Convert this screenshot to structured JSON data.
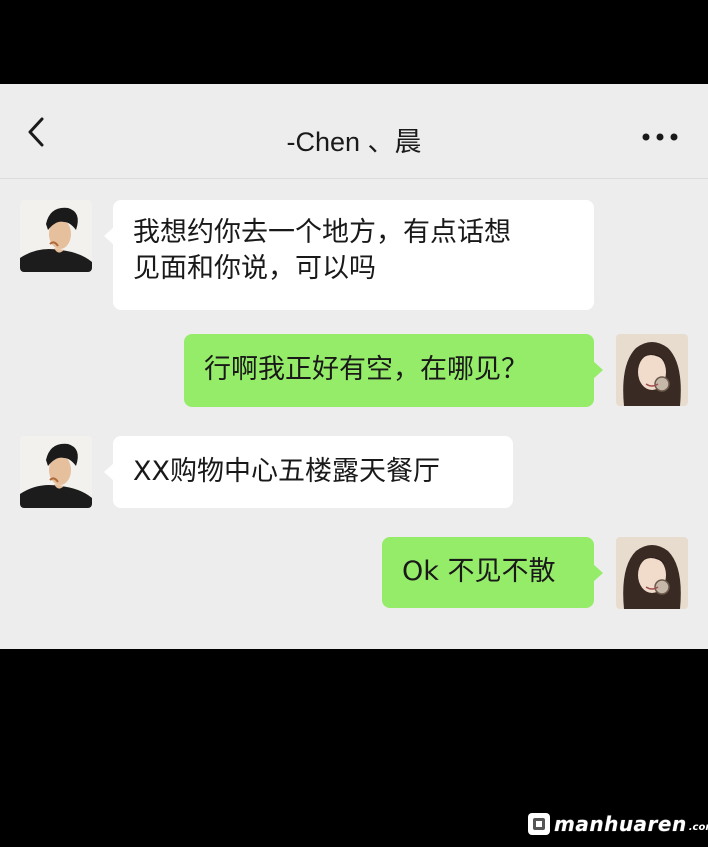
{
  "header": {
    "title": "-Chen 、晨",
    "back_icon": "chevron-left-icon",
    "more_icon": "more-dots-icon"
  },
  "messages": [
    {
      "side": "left",
      "sender": "contact",
      "text_lines": [
        "我想约你去一个地方，有点话想",
        "见面和你说，可以吗"
      ]
    },
    {
      "side": "right",
      "sender": "me",
      "text_lines": [
        "行啊我正好有空，在哪见？"
      ]
    },
    {
      "side": "left",
      "sender": "contact",
      "text_lines": [
        "XX购物中心五楼露天餐厅"
      ]
    },
    {
      "side": "right",
      "sender": "me",
      "text_lines": [
        "Ok 不见不散"
      ]
    }
  ],
  "colors": {
    "background": "#ededed",
    "bubble_in": "#ffffff",
    "bubble_out": "#95ec69",
    "frame": "#000000"
  },
  "watermark": {
    "text": "manhuaren",
    "suffix": ".com"
  }
}
